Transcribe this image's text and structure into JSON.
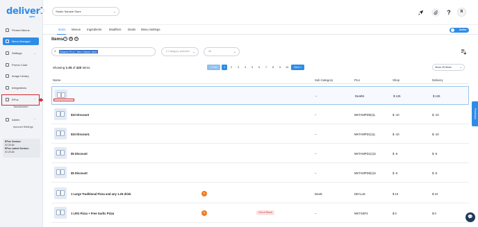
{
  "brand": {
    "name": "deliverit",
    "sub": "epos",
    "accent": "#2f8ce6"
  },
  "sidebar": {
    "items": [
      {
        "label": "Pinned Menus",
        "icon": "pin-icon"
      },
      {
        "label": "Menu Manager",
        "icon": "menu-icon",
        "active": true
      },
      {
        "label": "Settings",
        "icon": "gear-icon"
      },
      {
        "label": "Promo Code",
        "icon": "tag-icon"
      },
      {
        "label": "Image Library",
        "icon": "image-icon"
      },
      {
        "label": "Integrations",
        "icon": "plug-icon"
      },
      {
        "label": "EPos",
        "icon": "pos-icon"
      },
      {
        "label": "Admin",
        "icon": "user-icon"
      }
    ],
    "epos_sub": "Touchscreen",
    "admin_sub": "Account Settings",
    "version": {
      "epos_label": "EPos Version:",
      "epos_value": "02.20.64",
      "latest_label": "EPos Latest Version:",
      "latest_value": "02.20.64"
    }
  },
  "topbar": {
    "store": "Studio Sample Store",
    "avatar": "R",
    "help": "?"
  },
  "tabs": [
    "Items",
    "Menus",
    "Ingredients",
    "Modifiers",
    "Deals",
    "Menu Settings"
  ],
  "toggle_label": "Active",
  "content": {
    "title": "Items",
    "search_placeholder": "Search PLU / Item Name here",
    "category_placeholder": "0 Category selected",
    "type_value": "All",
    "showing_prefix": "Showing ",
    "showing_range": "1-25",
    "showing_of": " of ",
    "showing_total": "420",
    "showing_suffix": " items.",
    "pagination": {
      "prev": "< Prev",
      "pages": [
        "1",
        "2",
        "3",
        "4",
        "5",
        "6",
        "7",
        "8",
        "9",
        "10"
      ],
      "next": "Next >"
    },
    "per_page": "Show 25 Items"
  },
  "table": {
    "headers": {
      "name": "Name",
      "sub_category": "Sub Category",
      "plu": "PLU",
      "shop": "Shop",
      "delivery": "Delivery"
    },
    "rows": [
      {
        "name": "",
        "sub": "–",
        "plu": "Deal04",
        "shop": "$ 125",
        "delivery": "$ 125"
      },
      {
        "name": "$10 Discount",
        "sub": "–",
        "plu": "MKTAMPD9(1)L",
        "shop": "$ -10",
        "delivery": "$ -10"
      },
      {
        "name": "$10 Discount.",
        "sub": "–",
        "plu": "MKTAMPD1(1)L",
        "shop": "$ -10",
        "delivery": "$ -10"
      },
      {
        "name": "$5 Discount",
        "sub": "–",
        "plu": "MKTAMPD1(1)S",
        "shop": "$ -5",
        "delivery": "$ -5"
      },
      {
        "name": "$5 Discount",
        "sub": "–",
        "plu": "MKTAMPD9(1)S",
        "shop": "$ -5",
        "delivery": "$ -5"
      },
      {
        "name": "1 Large Traditional Pizza and any 1.25 drink",
        "sub": "Deals",
        "plu": "DEAL16",
        "shop": "$ 10",
        "delivery": "$ 10"
      },
      {
        "name": "1 LRG Pizza + Free Garlic Pizza",
        "sub": "–",
        "plu": "MKTSSP4",
        "shop": "$ 0",
        "delivery": "$ 0",
        "badge": "Out of Stock"
      }
    ]
  },
  "feedback_label": "Feedback"
}
